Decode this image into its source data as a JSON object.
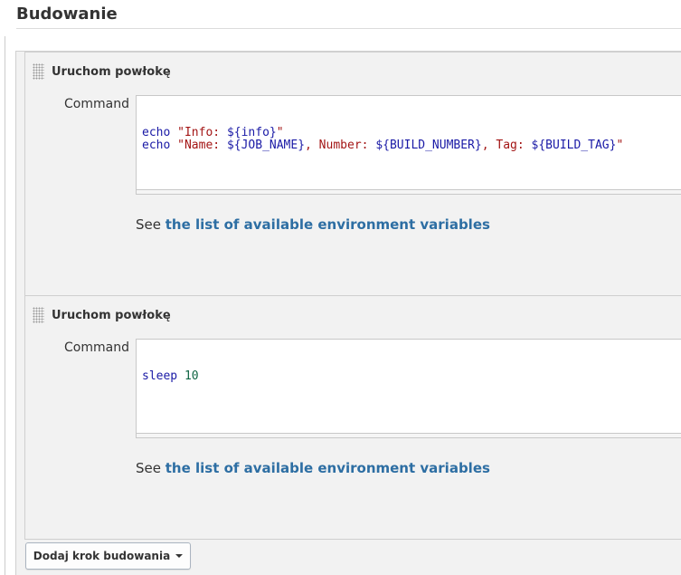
{
  "section": {
    "title": "Budowanie"
  },
  "steps": [
    {
      "title": "Uruchom powłokę",
      "command_label": "Command",
      "command_lines": [
        [
          {
            "t": "echo",
            "c": "kw"
          },
          {
            "t": " ",
            "c": "plain"
          },
          {
            "t": "\"Info: ",
            "c": "str"
          },
          {
            "t": "${info}",
            "c": "var"
          },
          {
            "t": "\"",
            "c": "str"
          }
        ],
        [
          {
            "t": "echo",
            "c": "kw"
          },
          {
            "t": " ",
            "c": "plain"
          },
          {
            "t": "\"Name: ",
            "c": "str"
          },
          {
            "t": "${JOB_NAME}",
            "c": "var"
          },
          {
            "t": ", Number: ",
            "c": "str"
          },
          {
            "t": "${BUILD_NUMBER}",
            "c": "var"
          },
          {
            "t": ", Tag: ",
            "c": "str"
          },
          {
            "t": "${BUILD_TAG}",
            "c": "var"
          },
          {
            "t": "\"",
            "c": "str"
          }
        ]
      ],
      "help_prefix": "See ",
      "help_link": "the list of available environment variables"
    },
    {
      "title": "Uruchom powłokę",
      "command_label": "Command",
      "command_lines": [
        [
          {
            "t": "sleep",
            "c": "kw"
          },
          {
            "t": " ",
            "c": "plain"
          },
          {
            "t": "10",
            "c": "num"
          }
        ]
      ],
      "help_prefix": "See ",
      "help_link": "the list of available environment variables"
    }
  ],
  "add_step_button": {
    "label": "Dodaj krok budowania",
    "icon": "caret-down-icon"
  },
  "colors": {
    "link": "#2d6ea3",
    "panel_bg": "#f2f2f2",
    "keyword": "#1a1aa6",
    "string": "#a31515",
    "number": "#116644"
  }
}
